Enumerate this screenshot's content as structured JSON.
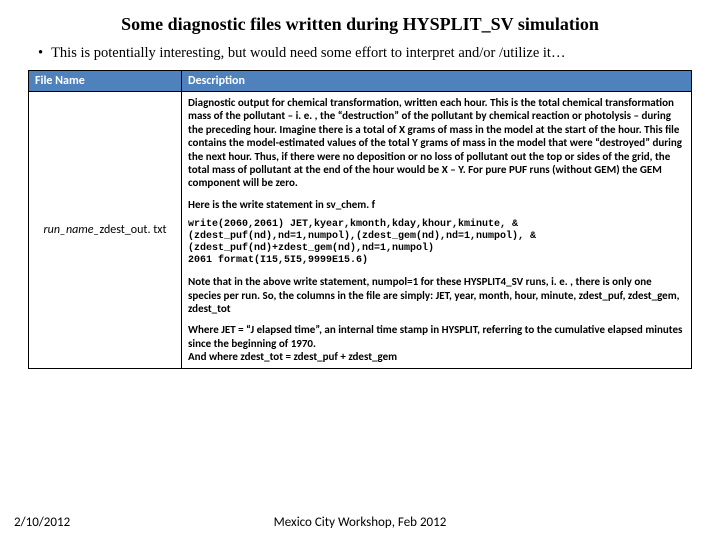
{
  "title": "Some diagnostic files written during HYSPLIT_SV simulation",
  "bullet": "This is potentially interesting, but would need some effort to interpret and/or /utilize it…",
  "table": {
    "headers": {
      "file": "File Name",
      "desc": "Description"
    },
    "filename_italic": "run_name_",
    "filename_rest": "zdest_out. txt",
    "p1": "Diagnostic output for chemical transformation, written each hour. This is the total chemical transformation mass of the pollutant – i. e. , the “destruction” of the pollutant by chemical reaction or photolysis – during the preceding hour.  Imagine there is a total of X grams of mass in the model at the start of the hour. This file contains the model-estimated values of the total Y grams of mass in the model that were “destroyed” during the next hour.  Thus, if there were no deposition or no loss of pollutant out the top or sides of the grid, the total mass of pollutant at the end of the hour would be X – Y. For pure PUF runs (without GEM) the GEM component will be zero.",
    "p2": "Here is the write statement in sv_chem. f",
    "code": "write(2060,2061) JET,kyear,kmonth,kday,khour,kminute, &\n(zdest_puf(nd),nd=1,numpol),(zdest_gem(nd),nd=1,numpol), &\n(zdest_puf(nd)+zdest_gem(nd),nd=1,numpol)\n2061 format(I15,5I5,9999E15.6)",
    "p3": "Note that in the above write statement, numpol=1 for these HYSPLIT4_SV runs, i. e. , there is only one species per run.  So, the columns in the file are simply: JET, year, month, hour, minute, zdest_puf, zdest_gem, zdest_tot",
    "p4": "Where JET = “J elapsed time”, an internal time stamp in HYSPLIT, referring to the cumulative elapsed minutes since the beginning of 1970.\nAnd where zdest_tot = zdest_puf + zdest_gem"
  },
  "footer": {
    "date": "2/10/2012",
    "venue": "Mexico City Workshop, Feb 2012"
  }
}
